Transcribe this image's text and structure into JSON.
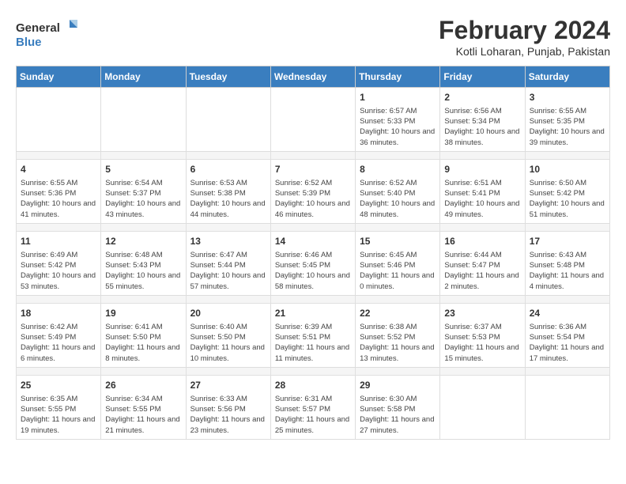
{
  "header": {
    "logo_line1": "General",
    "logo_line2": "Blue",
    "title": "February 2024",
    "subtitle": "Kotli Loharan, Punjab, Pakistan"
  },
  "days_of_week": [
    "Sunday",
    "Monday",
    "Tuesday",
    "Wednesday",
    "Thursday",
    "Friday",
    "Saturday"
  ],
  "weeks": [
    [
      {
        "num": "",
        "sunrise": "",
        "sunset": "",
        "daylight": ""
      },
      {
        "num": "",
        "sunrise": "",
        "sunset": "",
        "daylight": ""
      },
      {
        "num": "",
        "sunrise": "",
        "sunset": "",
        "daylight": ""
      },
      {
        "num": "",
        "sunrise": "",
        "sunset": "",
        "daylight": ""
      },
      {
        "num": "1",
        "sunrise": "Sunrise: 6:57 AM",
        "sunset": "Sunset: 5:33 PM",
        "daylight": "Daylight: 10 hours and 36 minutes."
      },
      {
        "num": "2",
        "sunrise": "Sunrise: 6:56 AM",
        "sunset": "Sunset: 5:34 PM",
        "daylight": "Daylight: 10 hours and 38 minutes."
      },
      {
        "num": "3",
        "sunrise": "Sunrise: 6:55 AM",
        "sunset": "Sunset: 5:35 PM",
        "daylight": "Daylight: 10 hours and 39 minutes."
      }
    ],
    [
      {
        "num": "4",
        "sunrise": "Sunrise: 6:55 AM",
        "sunset": "Sunset: 5:36 PM",
        "daylight": "Daylight: 10 hours and 41 minutes."
      },
      {
        "num": "5",
        "sunrise": "Sunrise: 6:54 AM",
        "sunset": "Sunset: 5:37 PM",
        "daylight": "Daylight: 10 hours and 43 minutes."
      },
      {
        "num": "6",
        "sunrise": "Sunrise: 6:53 AM",
        "sunset": "Sunset: 5:38 PM",
        "daylight": "Daylight: 10 hours and 44 minutes."
      },
      {
        "num": "7",
        "sunrise": "Sunrise: 6:52 AM",
        "sunset": "Sunset: 5:39 PM",
        "daylight": "Daylight: 10 hours and 46 minutes."
      },
      {
        "num": "8",
        "sunrise": "Sunrise: 6:52 AM",
        "sunset": "Sunset: 5:40 PM",
        "daylight": "Daylight: 10 hours and 48 minutes."
      },
      {
        "num": "9",
        "sunrise": "Sunrise: 6:51 AM",
        "sunset": "Sunset: 5:41 PM",
        "daylight": "Daylight: 10 hours and 49 minutes."
      },
      {
        "num": "10",
        "sunrise": "Sunrise: 6:50 AM",
        "sunset": "Sunset: 5:42 PM",
        "daylight": "Daylight: 10 hours and 51 minutes."
      }
    ],
    [
      {
        "num": "11",
        "sunrise": "Sunrise: 6:49 AM",
        "sunset": "Sunset: 5:42 PM",
        "daylight": "Daylight: 10 hours and 53 minutes."
      },
      {
        "num": "12",
        "sunrise": "Sunrise: 6:48 AM",
        "sunset": "Sunset: 5:43 PM",
        "daylight": "Daylight: 10 hours and 55 minutes."
      },
      {
        "num": "13",
        "sunrise": "Sunrise: 6:47 AM",
        "sunset": "Sunset: 5:44 PM",
        "daylight": "Daylight: 10 hours and 57 minutes."
      },
      {
        "num": "14",
        "sunrise": "Sunrise: 6:46 AM",
        "sunset": "Sunset: 5:45 PM",
        "daylight": "Daylight: 10 hours and 58 minutes."
      },
      {
        "num": "15",
        "sunrise": "Sunrise: 6:45 AM",
        "sunset": "Sunset: 5:46 PM",
        "daylight": "Daylight: 11 hours and 0 minutes."
      },
      {
        "num": "16",
        "sunrise": "Sunrise: 6:44 AM",
        "sunset": "Sunset: 5:47 PM",
        "daylight": "Daylight: 11 hours and 2 minutes."
      },
      {
        "num": "17",
        "sunrise": "Sunrise: 6:43 AM",
        "sunset": "Sunset: 5:48 PM",
        "daylight": "Daylight: 11 hours and 4 minutes."
      }
    ],
    [
      {
        "num": "18",
        "sunrise": "Sunrise: 6:42 AM",
        "sunset": "Sunset: 5:49 PM",
        "daylight": "Daylight: 11 hours and 6 minutes."
      },
      {
        "num": "19",
        "sunrise": "Sunrise: 6:41 AM",
        "sunset": "Sunset: 5:50 PM",
        "daylight": "Daylight: 11 hours and 8 minutes."
      },
      {
        "num": "20",
        "sunrise": "Sunrise: 6:40 AM",
        "sunset": "Sunset: 5:50 PM",
        "daylight": "Daylight: 11 hours and 10 minutes."
      },
      {
        "num": "21",
        "sunrise": "Sunrise: 6:39 AM",
        "sunset": "Sunset: 5:51 PM",
        "daylight": "Daylight: 11 hours and 11 minutes."
      },
      {
        "num": "22",
        "sunrise": "Sunrise: 6:38 AM",
        "sunset": "Sunset: 5:52 PM",
        "daylight": "Daylight: 11 hours and 13 minutes."
      },
      {
        "num": "23",
        "sunrise": "Sunrise: 6:37 AM",
        "sunset": "Sunset: 5:53 PM",
        "daylight": "Daylight: 11 hours and 15 minutes."
      },
      {
        "num": "24",
        "sunrise": "Sunrise: 6:36 AM",
        "sunset": "Sunset: 5:54 PM",
        "daylight": "Daylight: 11 hours and 17 minutes."
      }
    ],
    [
      {
        "num": "25",
        "sunrise": "Sunrise: 6:35 AM",
        "sunset": "Sunset: 5:55 PM",
        "daylight": "Daylight: 11 hours and 19 minutes."
      },
      {
        "num": "26",
        "sunrise": "Sunrise: 6:34 AM",
        "sunset": "Sunset: 5:55 PM",
        "daylight": "Daylight: 11 hours and 21 minutes."
      },
      {
        "num": "27",
        "sunrise": "Sunrise: 6:33 AM",
        "sunset": "Sunset: 5:56 PM",
        "daylight": "Daylight: 11 hours and 23 minutes."
      },
      {
        "num": "28",
        "sunrise": "Sunrise: 6:31 AM",
        "sunset": "Sunset: 5:57 PM",
        "daylight": "Daylight: 11 hours and 25 minutes."
      },
      {
        "num": "29",
        "sunrise": "Sunrise: 6:30 AM",
        "sunset": "Sunset: 5:58 PM",
        "daylight": "Daylight: 11 hours and 27 minutes."
      },
      {
        "num": "",
        "sunrise": "",
        "sunset": "",
        "daylight": ""
      },
      {
        "num": "",
        "sunrise": "",
        "sunset": "",
        "daylight": ""
      }
    ]
  ]
}
